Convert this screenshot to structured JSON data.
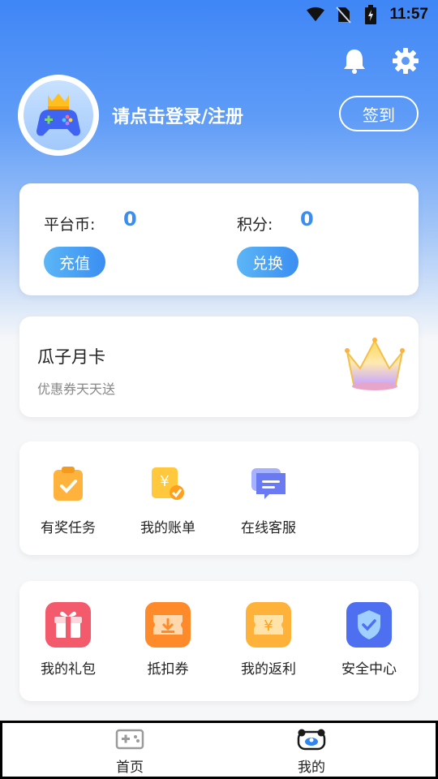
{
  "status_bar": {
    "time": "11:57"
  },
  "header": {
    "login_text": "请点击登录/注册",
    "signin_label": "签到"
  },
  "wallet": {
    "platform_coin_label": "平台币:",
    "platform_coin_value": "0",
    "points_label": "积分:",
    "points_value": "0",
    "recharge_label": "充值",
    "exchange_label": "兑换"
  },
  "monthly_card": {
    "title": "瓜子月卡",
    "subtitle": "优惠券天天送"
  },
  "services": [
    {
      "label": "有奖任务",
      "icon": "task-icon"
    },
    {
      "label": "我的账单",
      "icon": "bill-icon"
    },
    {
      "label": "在线客服",
      "icon": "chat-icon"
    }
  ],
  "features": [
    {
      "label": "我的礼包",
      "icon": "gift-icon"
    },
    {
      "label": "抵扣券",
      "icon": "coupon-icon"
    },
    {
      "label": "我的返利",
      "icon": "rebate-icon"
    },
    {
      "label": "安全中心",
      "icon": "shield-icon"
    }
  ],
  "bottom_nav": [
    {
      "label": "首页",
      "icon": "gamepad-icon"
    },
    {
      "label": "我的",
      "icon": "profile-icon"
    }
  ],
  "colors": {
    "accent": "#3a8ef2",
    "hero": "#3f86f6"
  }
}
